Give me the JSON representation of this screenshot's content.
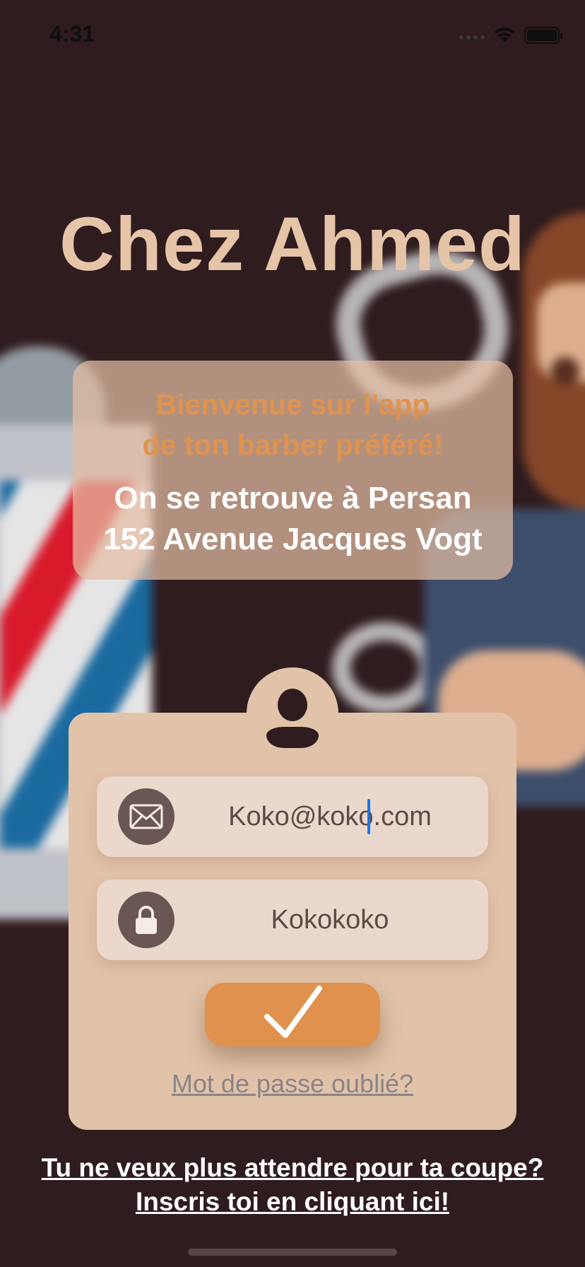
{
  "status_bar": {
    "time": "4:31"
  },
  "app": {
    "title": "Chez Ahmed"
  },
  "welcome": {
    "line1": "Bienvenue sur l'app",
    "line2": "de ton barber préféré!",
    "address_line1": "On se retrouve à Persan",
    "address_line2": "152 Avenue Jacques Vogt"
  },
  "login": {
    "email_value": "Koko@koko.com",
    "password_value": "Kokokoko",
    "forgot_password_label": "Mot de passe oublié?"
  },
  "signup": {
    "line1": "Tu ne veux plus attendre pour ta coupe?",
    "line2": "Inscris toi en cliquant ici!"
  },
  "colors": {
    "background": "#2f1c1e",
    "title": "#e6c4a8",
    "accent": "#e0914e",
    "card": "#e1c3a9",
    "field": "#ead8cc",
    "icon_circle": "#6b5655"
  },
  "icons": {
    "email": "envelope-icon",
    "password": "lock-icon",
    "submit": "checkmark-icon",
    "avatar": "user-icon"
  }
}
